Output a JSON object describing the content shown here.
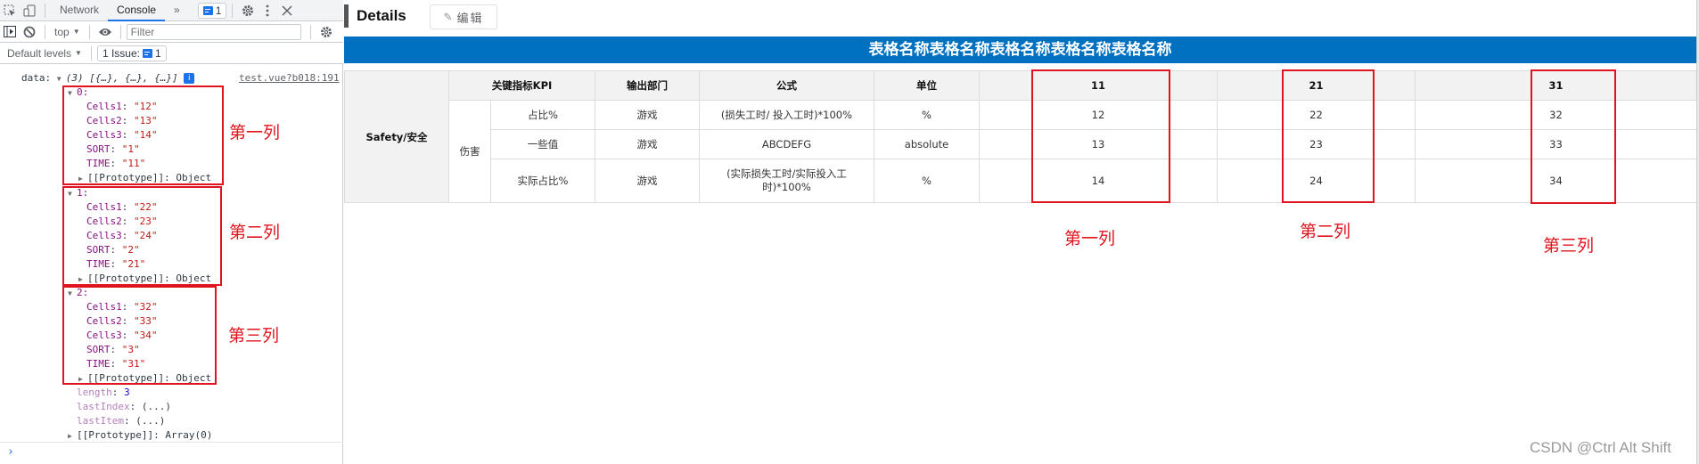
{
  "devtools": {
    "tabs": [
      "Network",
      "Console"
    ],
    "active_tab": "Console",
    "more_tabs_glyph": "»",
    "issues_badge_count": "1",
    "context_selector": "top",
    "filter_placeholder": "Filter",
    "levels_label": "Default levels",
    "issues_label": "1 Issue:",
    "issues_count": "1",
    "icons": {
      "inspect": "inspect-element-icon",
      "device": "device-toolbar-icon",
      "settings": "gear-icon",
      "menu": "kebab-menu-icon",
      "close": "close-icon",
      "sidebar": "sidebar-toggle-icon",
      "clear": "clear-console-icon",
      "live_expression": "eye-icon"
    }
  },
  "console": {
    "log_key": "data:",
    "array_summary_count": "(3)",
    "array_summary_items": "[{…}, {…}, {…}]",
    "source_link": "test.vue?b018:191",
    "items": [
      {
        "index": "0:",
        "fields": [
          {
            "key": "Cells1",
            "value": "\"12\""
          },
          {
            "key": "Cells2",
            "value": "\"13\""
          },
          {
            "key": "Cells3",
            "value": "\"14\""
          },
          {
            "key": "SORT",
            "value": "\"1\""
          },
          {
            "key": "TIME",
            "value": "\"11\""
          }
        ],
        "prototype": "[[Prototype]]: Object"
      },
      {
        "index": "1:",
        "fields": [
          {
            "key": "Cells1",
            "value": "\"22\""
          },
          {
            "key": "Cells2",
            "value": "\"23\""
          },
          {
            "key": "Cells3",
            "value": "\"24\""
          },
          {
            "key": "SORT",
            "value": "\"2\""
          },
          {
            "key": "TIME",
            "value": "\"21\""
          }
        ],
        "prototype": "[[Prototype]]: Object"
      },
      {
        "index": "2:",
        "fields": [
          {
            "key": "Cells1",
            "value": "\"32\""
          },
          {
            "key": "Cells2",
            "value": "\"33\""
          },
          {
            "key": "Cells3",
            "value": "\"34\""
          },
          {
            "key": "SORT",
            "value": "\"3\""
          },
          {
            "key": "TIME",
            "value": "\"31\""
          }
        ],
        "prototype": "[[Prototype]]: Object"
      }
    ],
    "length_key": "length",
    "length_value": "3",
    "last_index_key": "lastIndex",
    "last_item_key": "lastItem",
    "lazy_value": "(...)",
    "array_prototype": "[[Prototype]]: Array(0)",
    "prompt": "›"
  },
  "annotations": {
    "col1": "第一列",
    "col2": "第二列",
    "col3": "第三列",
    "color": "#e0141e"
  },
  "details": {
    "title": "Details",
    "edit_label": "编辑",
    "edit_icon": "✎",
    "table_title": "表格名称表格名称表格名称表格名称表格名称",
    "title_bar_color": "#0070c0",
    "table": {
      "group": "Safety/安全",
      "headers": [
        "关键指标KPI",
        "输出部门",
        "公式",
        "单位",
        "",
        "11",
        "",
        "21",
        "31"
      ],
      "subgroup": "伤害",
      "rows": [
        {
          "kpi": "占比%",
          "dept": "游戏",
          "formula": "(损失工时/ 投入工时)*100%",
          "unit": "%",
          "c1": "12",
          "c2": "22",
          "c3": "32"
        },
        {
          "kpi": "一些值",
          "dept": "游戏",
          "formula": "ABCDEFG",
          "unit": "absolute",
          "c1": "13",
          "c2": "23",
          "c3": "33"
        },
        {
          "kpi": "实际占比%",
          "dept": "游戏",
          "formula": "(实际损失工时/实际投入工时)*100%",
          "unit": "%",
          "c1": "14",
          "c2": "24",
          "c3": "34"
        }
      ]
    }
  },
  "watermark": "CSDN @Ctrl Alt Shift"
}
